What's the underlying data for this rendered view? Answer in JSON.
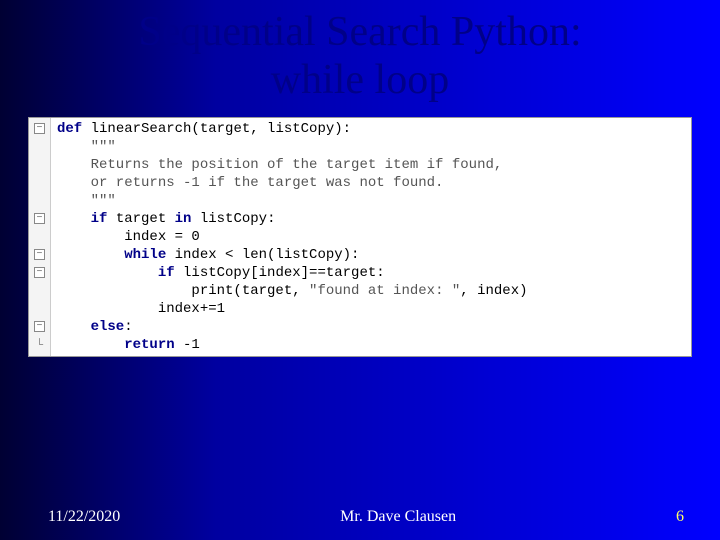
{
  "title_line1": "Sequential Search Python:",
  "title_line2": "while loop",
  "code": {
    "l1_def": "def",
    "l1_rest": " linearSearch(target, listCopy):",
    "l2": "    \"\"\"",
    "l3": "    Returns the position of the target item if found,",
    "l4": "    or returns -1 if the target was not found.",
    "l5": "    \"\"\"",
    "l6_if": "    if",
    "l6_mid": " target ",
    "l6_in": "in",
    "l6_rest": " listCopy:",
    "l7": "        index = 0",
    "l8_while": "        while",
    "l8_rest": " index < len(listCopy):",
    "l9_if": "            if",
    "l9_rest": " listCopy[index]==target:",
    "l10_a": "                print(target, ",
    "l10_str": "\"found at index: \"",
    "l10_b": ", index)",
    "l11": "            index+=1",
    "l12_else": "    else",
    "l12_rest": ":",
    "l13_ret": "        return",
    "l13_rest": " -1"
  },
  "gutter": {
    "minus": "−",
    "end": "└"
  },
  "footer": {
    "date": "11/22/2020",
    "author": "Mr. Dave Clausen",
    "page": "6"
  }
}
